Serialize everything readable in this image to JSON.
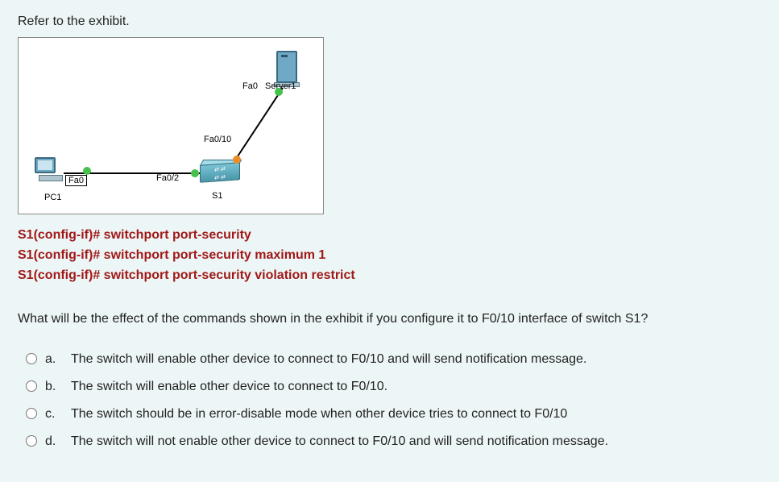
{
  "intro": "Refer to the exhibit.",
  "exhibit": {
    "devices": {
      "pc": {
        "label": "PC1",
        "port": "Fa0"
      },
      "switch": {
        "label": "S1",
        "port_left": "Fa0/2",
        "port_up": "Fa0/10"
      },
      "server": {
        "label": "Server1",
        "port": "Fa0"
      }
    }
  },
  "cli": [
    "S1(config-if)# switchport port-security",
    "S1(config-if)# switchport port-security maximum 1",
    "S1(config-if)# switchport port-security violation restrict"
  ],
  "question": "What will be the effect of the commands shown in the exhibit if you configure it to F0/10 interface of switch S1?",
  "options": [
    {
      "letter": "a.",
      "text": "The switch will enable other device to connect to F0/10 and will send notification message."
    },
    {
      "letter": "b.",
      "text": "The switch will enable other device to connect to F0/10."
    },
    {
      "letter": "c.",
      "text": "The switch should be in error-disable mode when other device tries to connect to F0/10"
    },
    {
      "letter": "d.",
      "text": "The switch will not enable other device to connect to F0/10 and will send notification message."
    }
  ]
}
